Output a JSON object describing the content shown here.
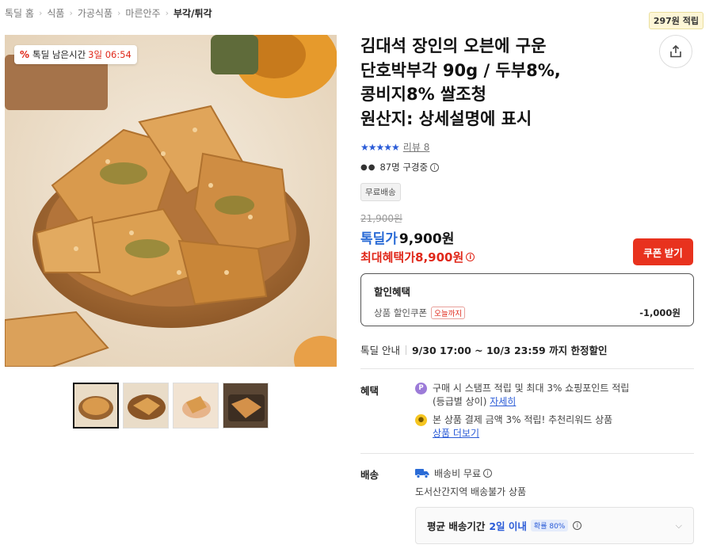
{
  "breadcrumb": [
    "톡딜 홈",
    "식품",
    "가공식품",
    "마른안주",
    "부각/튀각"
  ],
  "points_badge": "297원 적립",
  "deal_timer": {
    "label": "톡딜 남은시간",
    "value": "3일 06:54"
  },
  "product": {
    "title_lines": [
      "김대석 장인의 오븐에 구운",
      "단호박부각 90g / 두부8%,",
      "콩비지8% 쌀조청",
      "원산지: 상세설명에 표시"
    ]
  },
  "rating": {
    "stars": "★★★★★",
    "review_text": "리뷰 8"
  },
  "viewers_text": "87명 구경중",
  "shipping_badge": "무료배송",
  "pricing": {
    "original": "21,900원",
    "deal_label": "톡딜가",
    "deal_value": "9,900원",
    "max_label": "최대혜택가",
    "max_value": "8,900원"
  },
  "coupon_button": "쿠폰 받기",
  "discount": {
    "title": "할인혜택",
    "row_label": "상품 할인쿠폰",
    "row_tag": "오늘까지",
    "row_amount": "-1,000원"
  },
  "deal_info": {
    "label": "톡딜 안내",
    "value": "9/30 17:00 ~ 10/3 23:59 까지 한정할인"
  },
  "benefits": {
    "label": "혜택",
    "item1_line1": "구매 시 스탬프 적립 및 최대 3% 쇼핑포인트 적립",
    "item1_line2": "(등급별 상이)",
    "item1_link": "자세히",
    "item2_line1": "본 상품 결제 금액 3% 적립! 추천리워드 상품",
    "item2_link": "상품 더보기"
  },
  "shipping": {
    "label": "배송",
    "fee": "배송비 무료",
    "note": "도서산간지역 배송불가 상품",
    "avg_label": "평균 배송기간",
    "avg_value": "2일 이내",
    "prob": "확률 80%"
  },
  "colors": {
    "accent_red": "#e0281a",
    "coupon_red": "#e8321e",
    "accent_blue": "#2a5bd7"
  },
  "icons": [
    "percent-icon",
    "share-icon",
    "star-icon",
    "eyes-icon",
    "info-icon",
    "point-icon",
    "reward-icon",
    "truck-icon",
    "chevron-down-icon"
  ]
}
